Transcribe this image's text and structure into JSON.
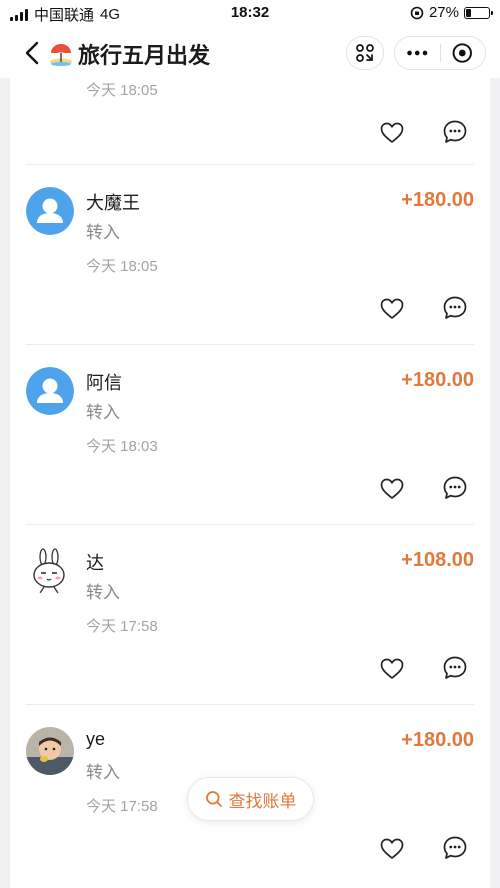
{
  "status_bar": {
    "carrier": "中国联通",
    "network": "4G",
    "time": "18:32",
    "battery": "27%",
    "battery_level": 0.27
  },
  "nav": {
    "title": "旅行五月出发",
    "title_icon": "beach-umbrella-icon"
  },
  "colors": {
    "amount": "#e2793c",
    "avatar_default": "#4fa3ea"
  },
  "entries": [
    {
      "time": "今天 18:05",
      "partial": true
    },
    {
      "name": "大魔王",
      "type": "转入",
      "amount": "+180.00",
      "time": "今天 18:05",
      "avatar": "default-person"
    },
    {
      "name": "阿信",
      "type": "转入",
      "amount": "+180.00",
      "time": "今天 18:03",
      "avatar": "default-person"
    },
    {
      "name": "达",
      "type": "转入",
      "amount": "+108.00",
      "time": "今天 17:58",
      "avatar": "cartoon-rabbit"
    },
    {
      "name": "ye",
      "type": "转入",
      "amount": "+180.00",
      "time": "今天 17:58",
      "avatar": "baby-photo"
    }
  ],
  "find_bill_label": "查找账单"
}
